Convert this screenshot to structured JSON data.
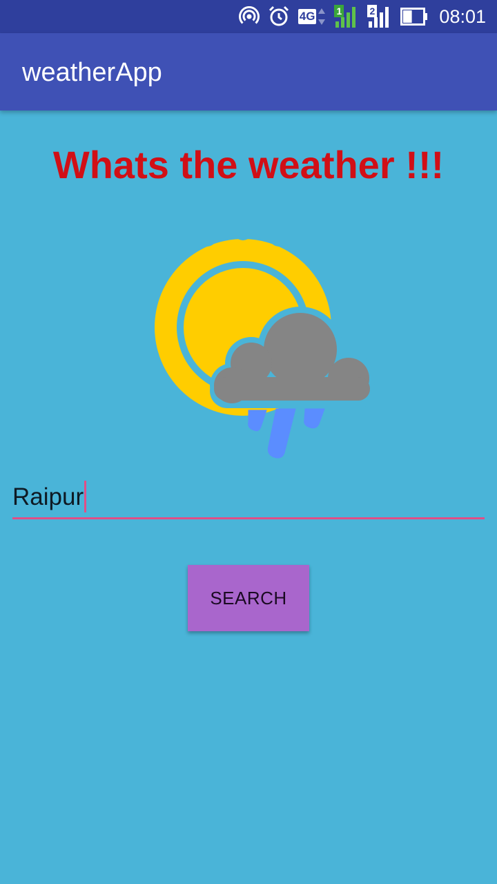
{
  "status_bar": {
    "time": "08:01",
    "network_type": "4G",
    "sim1_label": "1",
    "sim2_label": "2",
    "icons": [
      "hotspot-icon",
      "alarm-icon",
      "network-4g-icon",
      "signal-sim1-icon",
      "signal-sim2-icon",
      "battery-icon"
    ],
    "battery_level": 0.45
  },
  "app_bar": {
    "title": "weatherApp"
  },
  "main": {
    "headline": "Whats the weather !!!",
    "weather_icon": "partly-cloudy-rain-icon",
    "city_input": {
      "value": "Raipur"
    },
    "search_button_label": "SEARCH"
  },
  "colors": {
    "status_bar": "#2f3f9d",
    "app_bar": "#3f51b5",
    "background": "#4ab4d8",
    "headline": "#d10f16",
    "input_underline": "#e14e86",
    "button": "#a966cc"
  }
}
